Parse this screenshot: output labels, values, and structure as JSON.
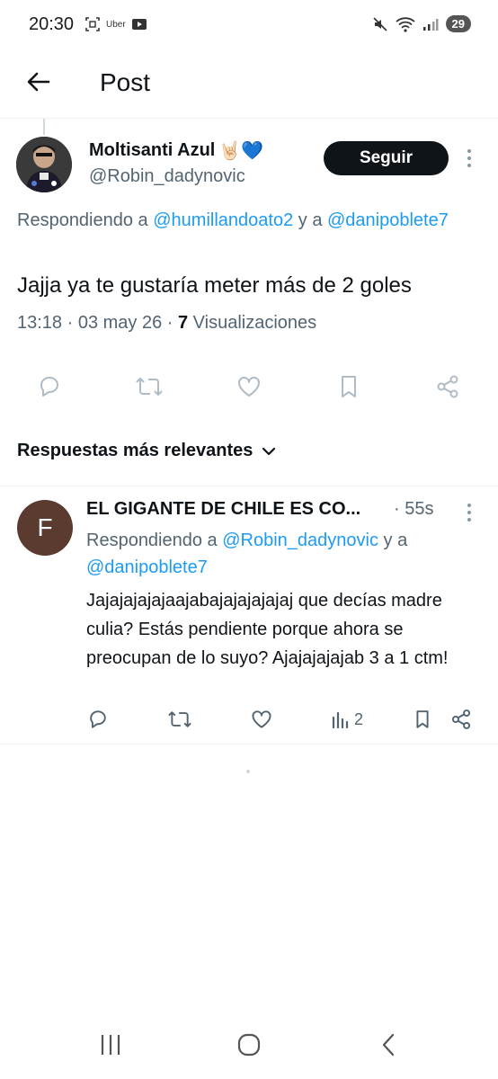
{
  "status_bar": {
    "time": "20:30",
    "uber_label": "Uber",
    "battery": "29"
  },
  "header": {
    "title": "Post"
  },
  "main_post": {
    "author_name": "Moltisanti Azul",
    "author_emojis": "🤘🏻💙",
    "handle": "@Robin_dadynovic",
    "follow_label": "Seguir",
    "replying_prefix": "Respondiendo a ",
    "replying_user1": "@humillandoato2",
    "replying_mid": " y a ",
    "replying_user2": "@danipoblete7",
    "text": "Jajja ya te gustaría meter más de 2 goles",
    "timestamp": "13:18 · 03 may 26 · ",
    "views_count": "7",
    "views_label": " Visualizaciones",
    "actions": [
      "reply-icon",
      "retweet-icon",
      "like-icon",
      "bookmark-icon",
      "share-icon"
    ]
  },
  "sort": {
    "label": "Respuestas más relevantes"
  },
  "reply": {
    "avatar_letter": "F",
    "author_name": "EL GIGANTE DE CHILE ES CO...",
    "time": "· 55s",
    "replying_prefix": "Respondiendo a ",
    "replying_user1": "@Robin_dadynovic",
    "replying_mid": " y a ",
    "replying_user2": "@danipoblete7",
    "text": "Jajajajajajaajabajajajajajaj que decías madre culia? Estás pendiente porque ahora se preocupan de lo suyo? Ajajajajajab 3 a 1 ctm!",
    "views": "2"
  },
  "colors": {
    "link": "#1d9bf0",
    "secondary_text": "#536471",
    "primary_text": "#0f1419",
    "follow_bg": "#0f1419",
    "reply_avatar_bg": "#5b3a30"
  }
}
